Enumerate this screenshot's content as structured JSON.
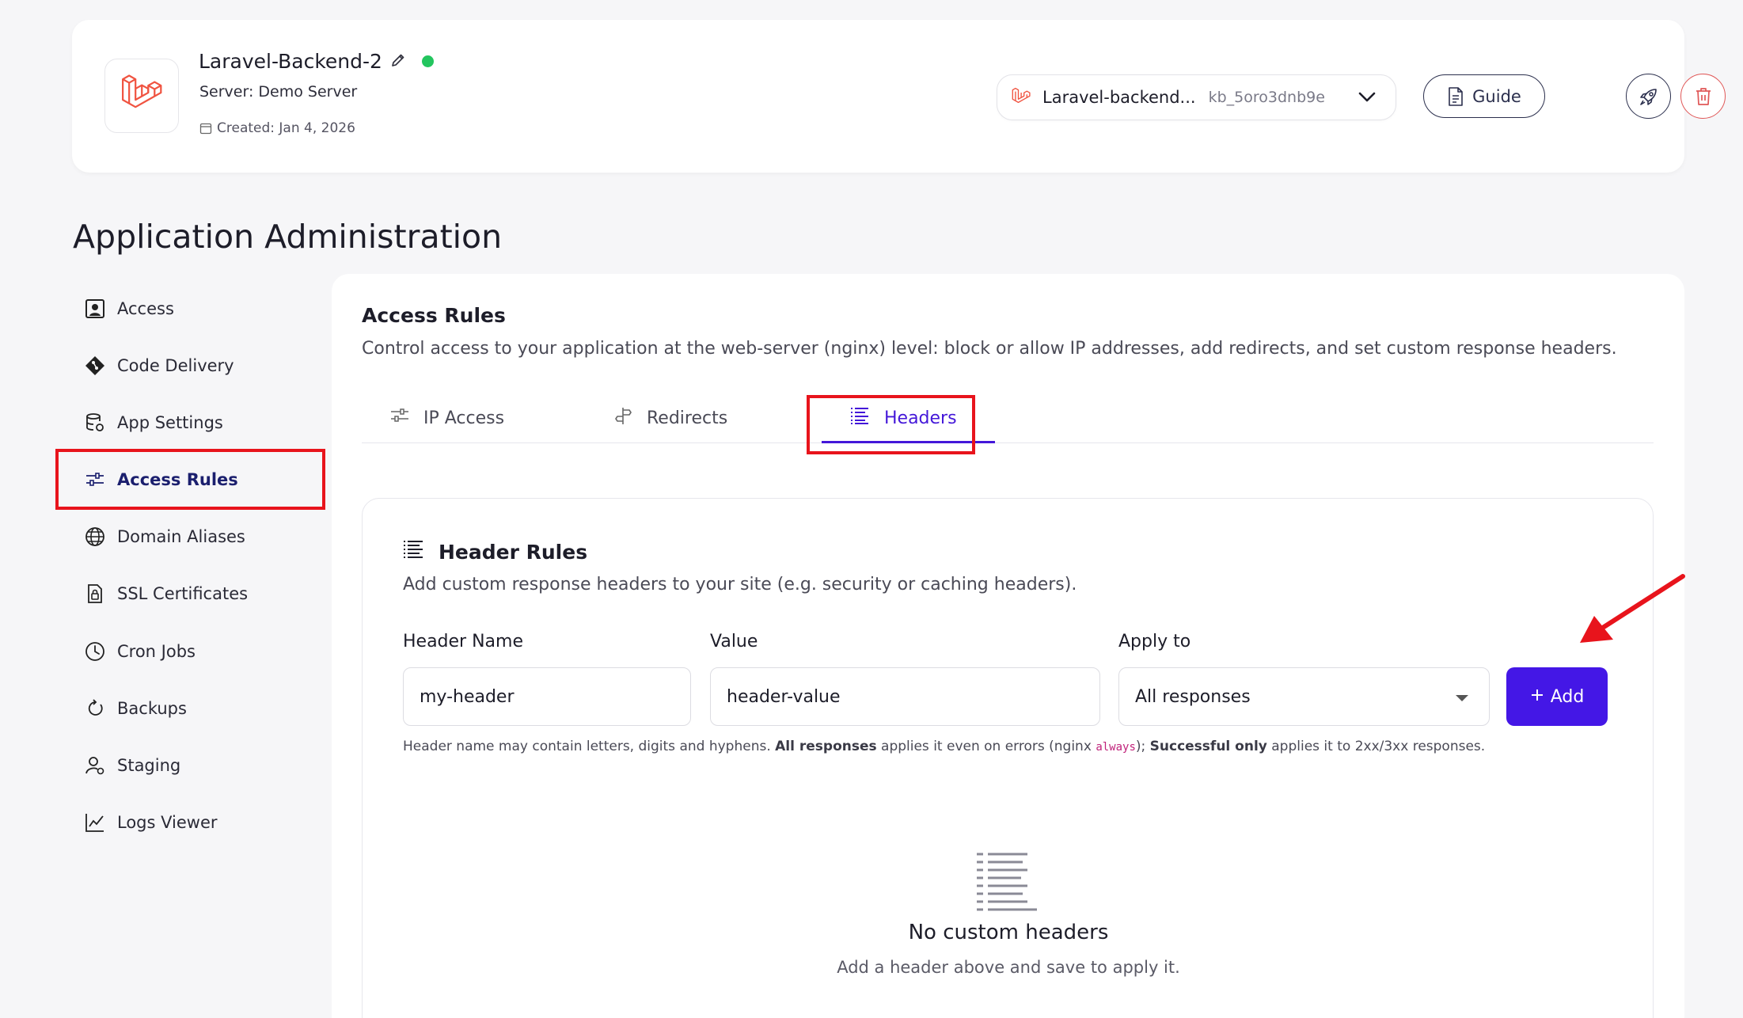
{
  "app": {
    "name": "Laravel-Backend-2",
    "server": "Server: Demo Server",
    "created": "Created: Jan 4, 2026",
    "status": "online",
    "selector_name": "Laravel-backend...",
    "selector_key": "kb_5oro3dnb9e",
    "guide_label": "Guide"
  },
  "page_title": "Application Administration",
  "sidebar": {
    "items": [
      {
        "label": "Access",
        "icon": "user-card-icon"
      },
      {
        "label": "Code Delivery",
        "icon": "git-icon"
      },
      {
        "label": "App Settings",
        "icon": "database-gear-icon"
      },
      {
        "label": "Access Rules",
        "icon": "sliders-icon"
      },
      {
        "label": "Domain Aliases",
        "icon": "globe-icon"
      },
      {
        "label": "SSL Certificates",
        "icon": "certificate-lock-icon"
      },
      {
        "label": "Cron Jobs",
        "icon": "clock-icon"
      },
      {
        "label": "Backups",
        "icon": "refresh-icon"
      },
      {
        "label": "Staging",
        "icon": "user-gear-icon"
      },
      {
        "label": "Logs Viewer",
        "icon": "chart-line-icon"
      }
    ],
    "active": "Access Rules"
  },
  "main": {
    "title": "Access Rules",
    "description": "Control access to your application at the web-server (nginx) level: block or allow IP addresses, add redirects, and set custom response headers.",
    "tabs": [
      {
        "label": "IP Access"
      },
      {
        "label": "Redirects"
      },
      {
        "label": "Headers"
      }
    ],
    "active_tab": "Headers"
  },
  "header_rules": {
    "title": "Header Rules",
    "description": "Add custom response headers to your site (e.g. security or caching headers).",
    "name_label": "Header Name",
    "name_value": "my-header",
    "value_label": "Value",
    "value_value": "header-value",
    "apply_label": "Apply to",
    "apply_value": "All responses",
    "add_label": "Add",
    "hint_1": "Header name may contain letters, digits and hyphens. ",
    "hint_b1": "All responses",
    "hint_2": " applies it even on errors (nginx ",
    "hint_code": "always",
    "hint_3": "); ",
    "hint_b2": "Successful only",
    "hint_4": " applies it to 2xx/3xx responses.",
    "empty_title": "No custom headers",
    "empty_subtitle": "Add a header above and save to apply it."
  },
  "colors": {
    "accent": "#4417e6",
    "highlight": "#e8141c",
    "status_online": "#23c55e",
    "laravel": "#f05340"
  }
}
